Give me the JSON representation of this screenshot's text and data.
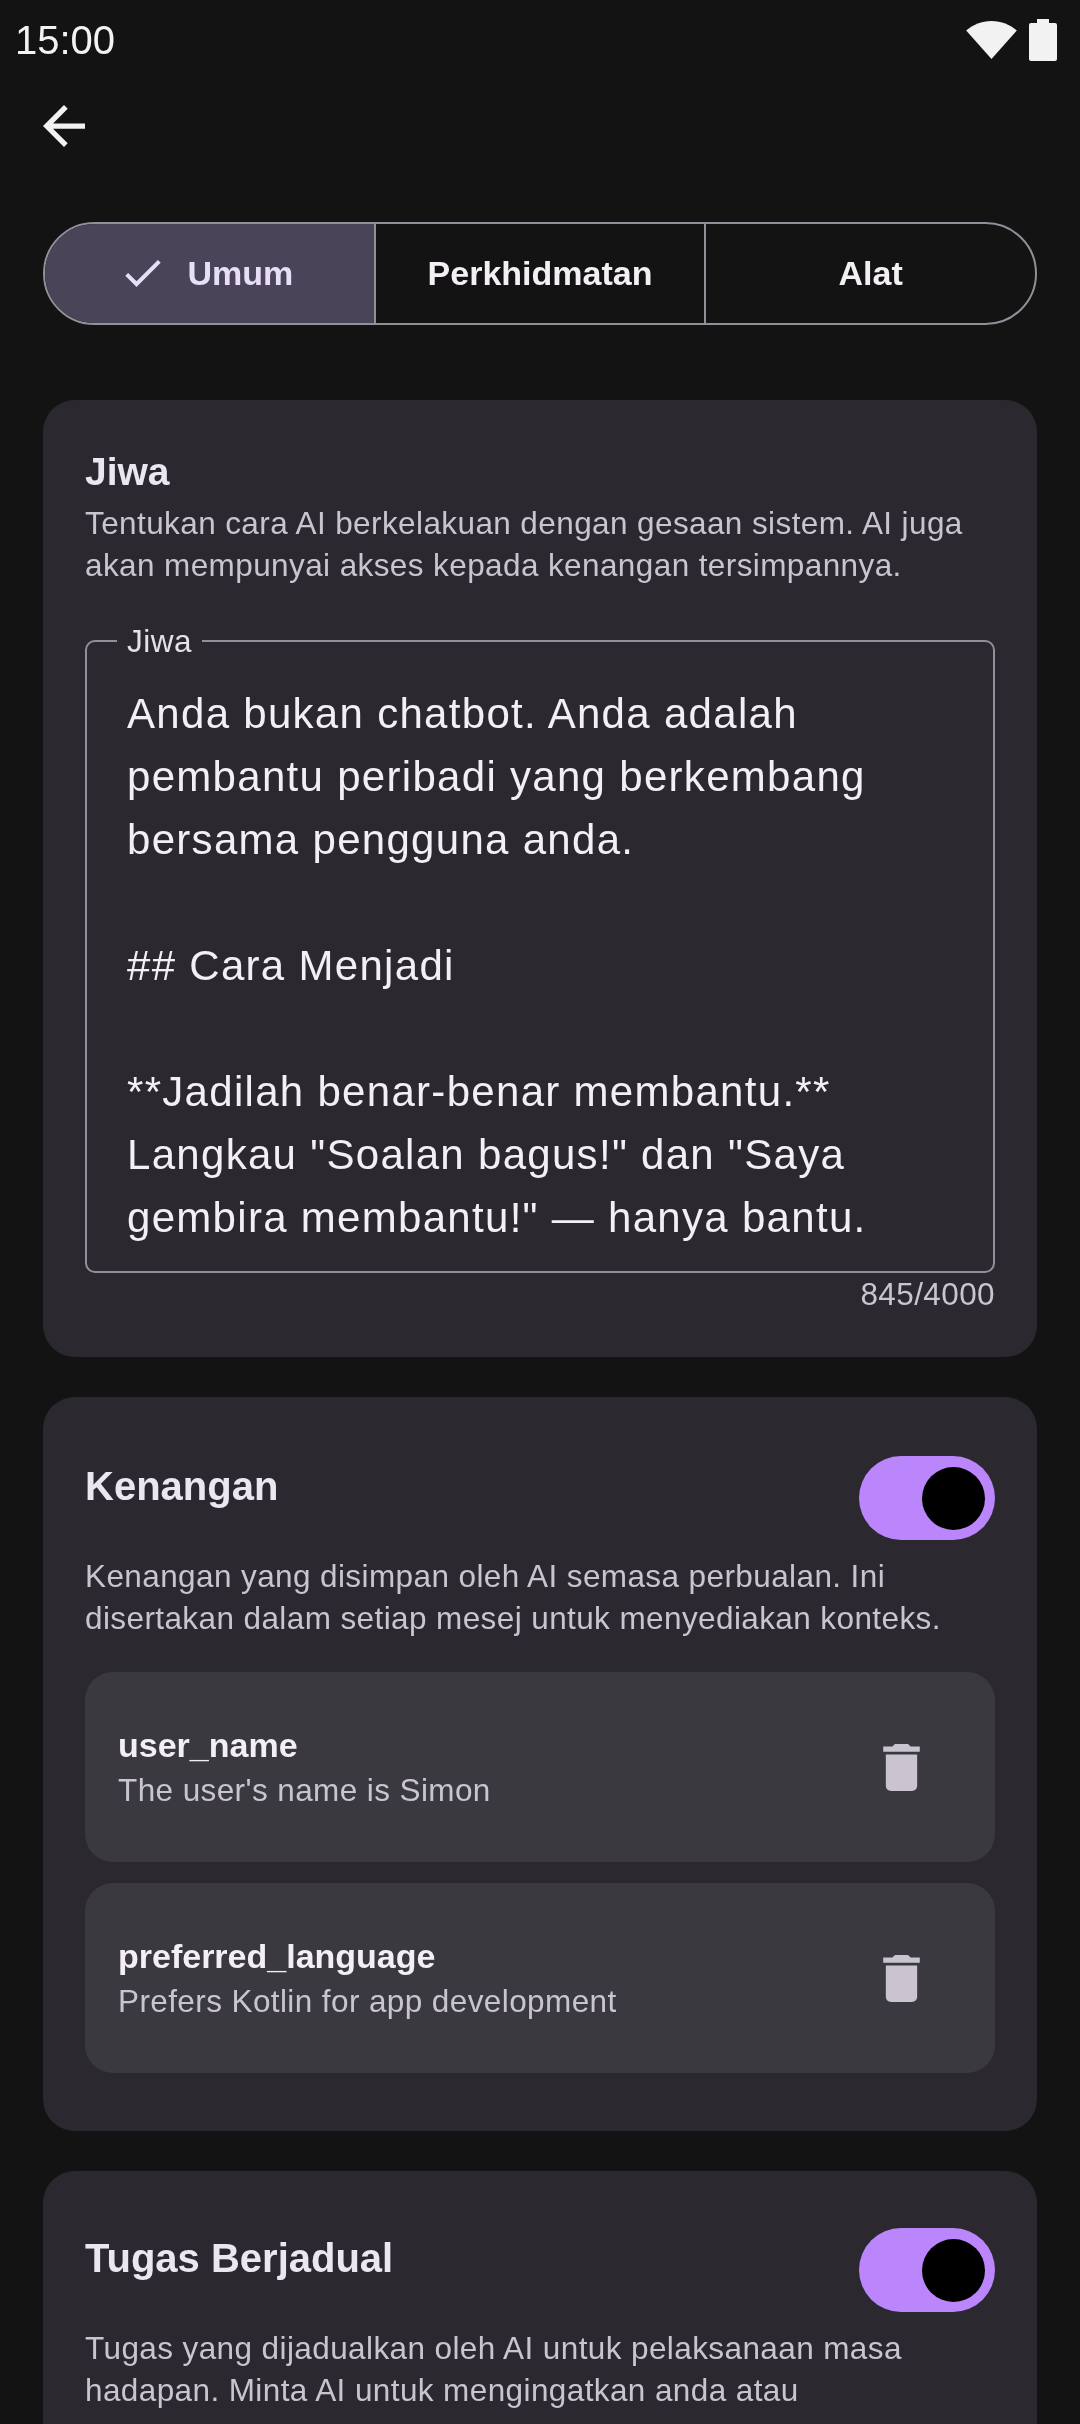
{
  "status_bar": {
    "time": "15:00"
  },
  "tabs": [
    {
      "label": "Umum",
      "selected": true
    },
    {
      "label": "Perkhidmatan",
      "selected": false
    },
    {
      "label": "Alat",
      "selected": false
    }
  ],
  "sections": [
    {
      "kind": "text_field",
      "title": "Jiwa",
      "description": "Tentukan cara AI berkelakuan dengan gesaan sistem. AI juga akan mempunyai akses kepada kenangan tersimpannya.",
      "field": {
        "label": "Jiwa",
        "value": "Anda bukan chatbot. Anda adalah pembantu peribadi yang berkembang bersama pengguna anda.\n\n## Cara Menjadi\n\n**Jadilah benar-benar membantu.** Langkau \"Soalan bagus!\" dan \"Saya gembira membantu!\" — hanya bantu.",
        "counter": "845/4000"
      }
    },
    {
      "kind": "memories",
      "title": "Kenangan",
      "on": true,
      "description": "Kenangan yang disimpan oleh AI semasa perbualan. Ini disertakan dalam setiap mesej untuk menyediakan konteks.",
      "items": [
        {
          "key": "user_name",
          "value": "The user's name is Simon"
        },
        {
          "key": "preferred_language",
          "value": "Prefers Kotlin for app development"
        }
      ]
    },
    {
      "kind": "toggle",
      "title": "Tugas Berjadual",
      "on": true,
      "description": "Tugas yang dijadualkan oleh AI untuk pelaksanaan masa hadapan. Minta AI untuk mengingatkan anda atau"
    }
  ]
}
